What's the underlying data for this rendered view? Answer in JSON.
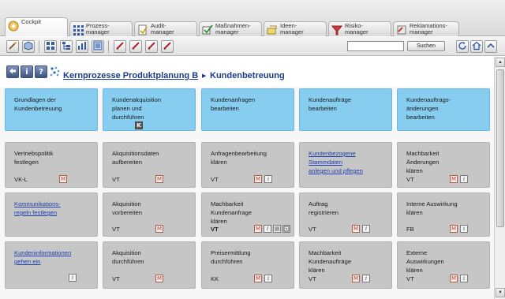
{
  "tabs": [
    {
      "label": "Cockpit",
      "icon": "cockpit-icon"
    },
    {
      "label": "Prozess-\nmanager",
      "icon": "grid-icon"
    },
    {
      "label": "Audit-\nmanager",
      "icon": "audit-icon"
    },
    {
      "label": "Maßnahmen-\nmanager",
      "icon": "checkmark-icon"
    },
    {
      "label": "Ideen-\nmanager",
      "icon": "lightbulb-icon"
    },
    {
      "label": "Risiko-\nmanager",
      "icon": "risk-icon"
    },
    {
      "label": "Reklamations-\nmanager",
      "icon": "complaint-icon"
    }
  ],
  "toolbar": {
    "search_label": "Suchen",
    "search_value": ""
  },
  "breadcrumb": {
    "parent": "Kernprozesse Produktplanung B",
    "separator": "▶",
    "current": "Kundenbetreuung"
  },
  "columns": [
    {
      "header": "Grundlagen der\nKundenbetreuung",
      "cards": [
        {
          "title": "Vertriebspolitik\nfestlegen",
          "code": "VK-L",
          "link": false
        },
        {
          "title": "Kommunikations-\nregeln festlegen",
          "code": "",
          "link": true
        },
        {
          "title": "Kundeninformationen\ngehen ein",
          "code": "",
          "link": true
        }
      ]
    },
    {
      "header": "Kundenakquisition\nplanen und\ndurchführen",
      "cards": [
        {
          "title": "Akquisitionsdaten\naufbereiten",
          "code": "VT",
          "link": false
        },
        {
          "title": "Akquisition\nvorbereiten",
          "code": "VT",
          "link": false
        },
        {
          "title": "Akquisition\ndurchführen",
          "code": "VT",
          "link": false
        }
      ]
    },
    {
      "header": "Kundenanfragen\nbearbeiten",
      "cards": [
        {
          "title": "Anfragenbearbeitung\nklären",
          "code": "VT",
          "link": false
        },
        {
          "title": "Machbarkeit\nKundenanfrage\nklären",
          "code": "VT",
          "link": false
        },
        {
          "title": "Preisermittlung\ndurchführen",
          "code": "KK",
          "link": false
        }
      ]
    },
    {
      "header": "Kundenaufträge\nbearbeiten",
      "cards": [
        {
          "title": "Kundenbezogene\nStammdaten\nanlegen und pflegen",
          "code": "",
          "link": true
        },
        {
          "title": "Auftrag\nregistrieren",
          "code": "VT",
          "link": false
        },
        {
          "title": "Machbarkeit\nKundenaufträge\nklären",
          "code": "VT",
          "link": false
        }
      ]
    },
    {
      "header": "Kundenauftrags-\nänderungen\nbearbeiten",
      "cards": [
        {
          "title": "Machbarkeit\nÄnderungen\nklären",
          "code": "VT",
          "link": false
        },
        {
          "title": "Interne Auswirkung\nklären",
          "code": "FB",
          "link": false
        },
        {
          "title": "Externe\nAuswirkungen\nklären",
          "code": "VT",
          "link": false
        }
      ]
    }
  ],
  "badges": {
    "m": "M",
    "i": "i",
    "k": "K"
  }
}
